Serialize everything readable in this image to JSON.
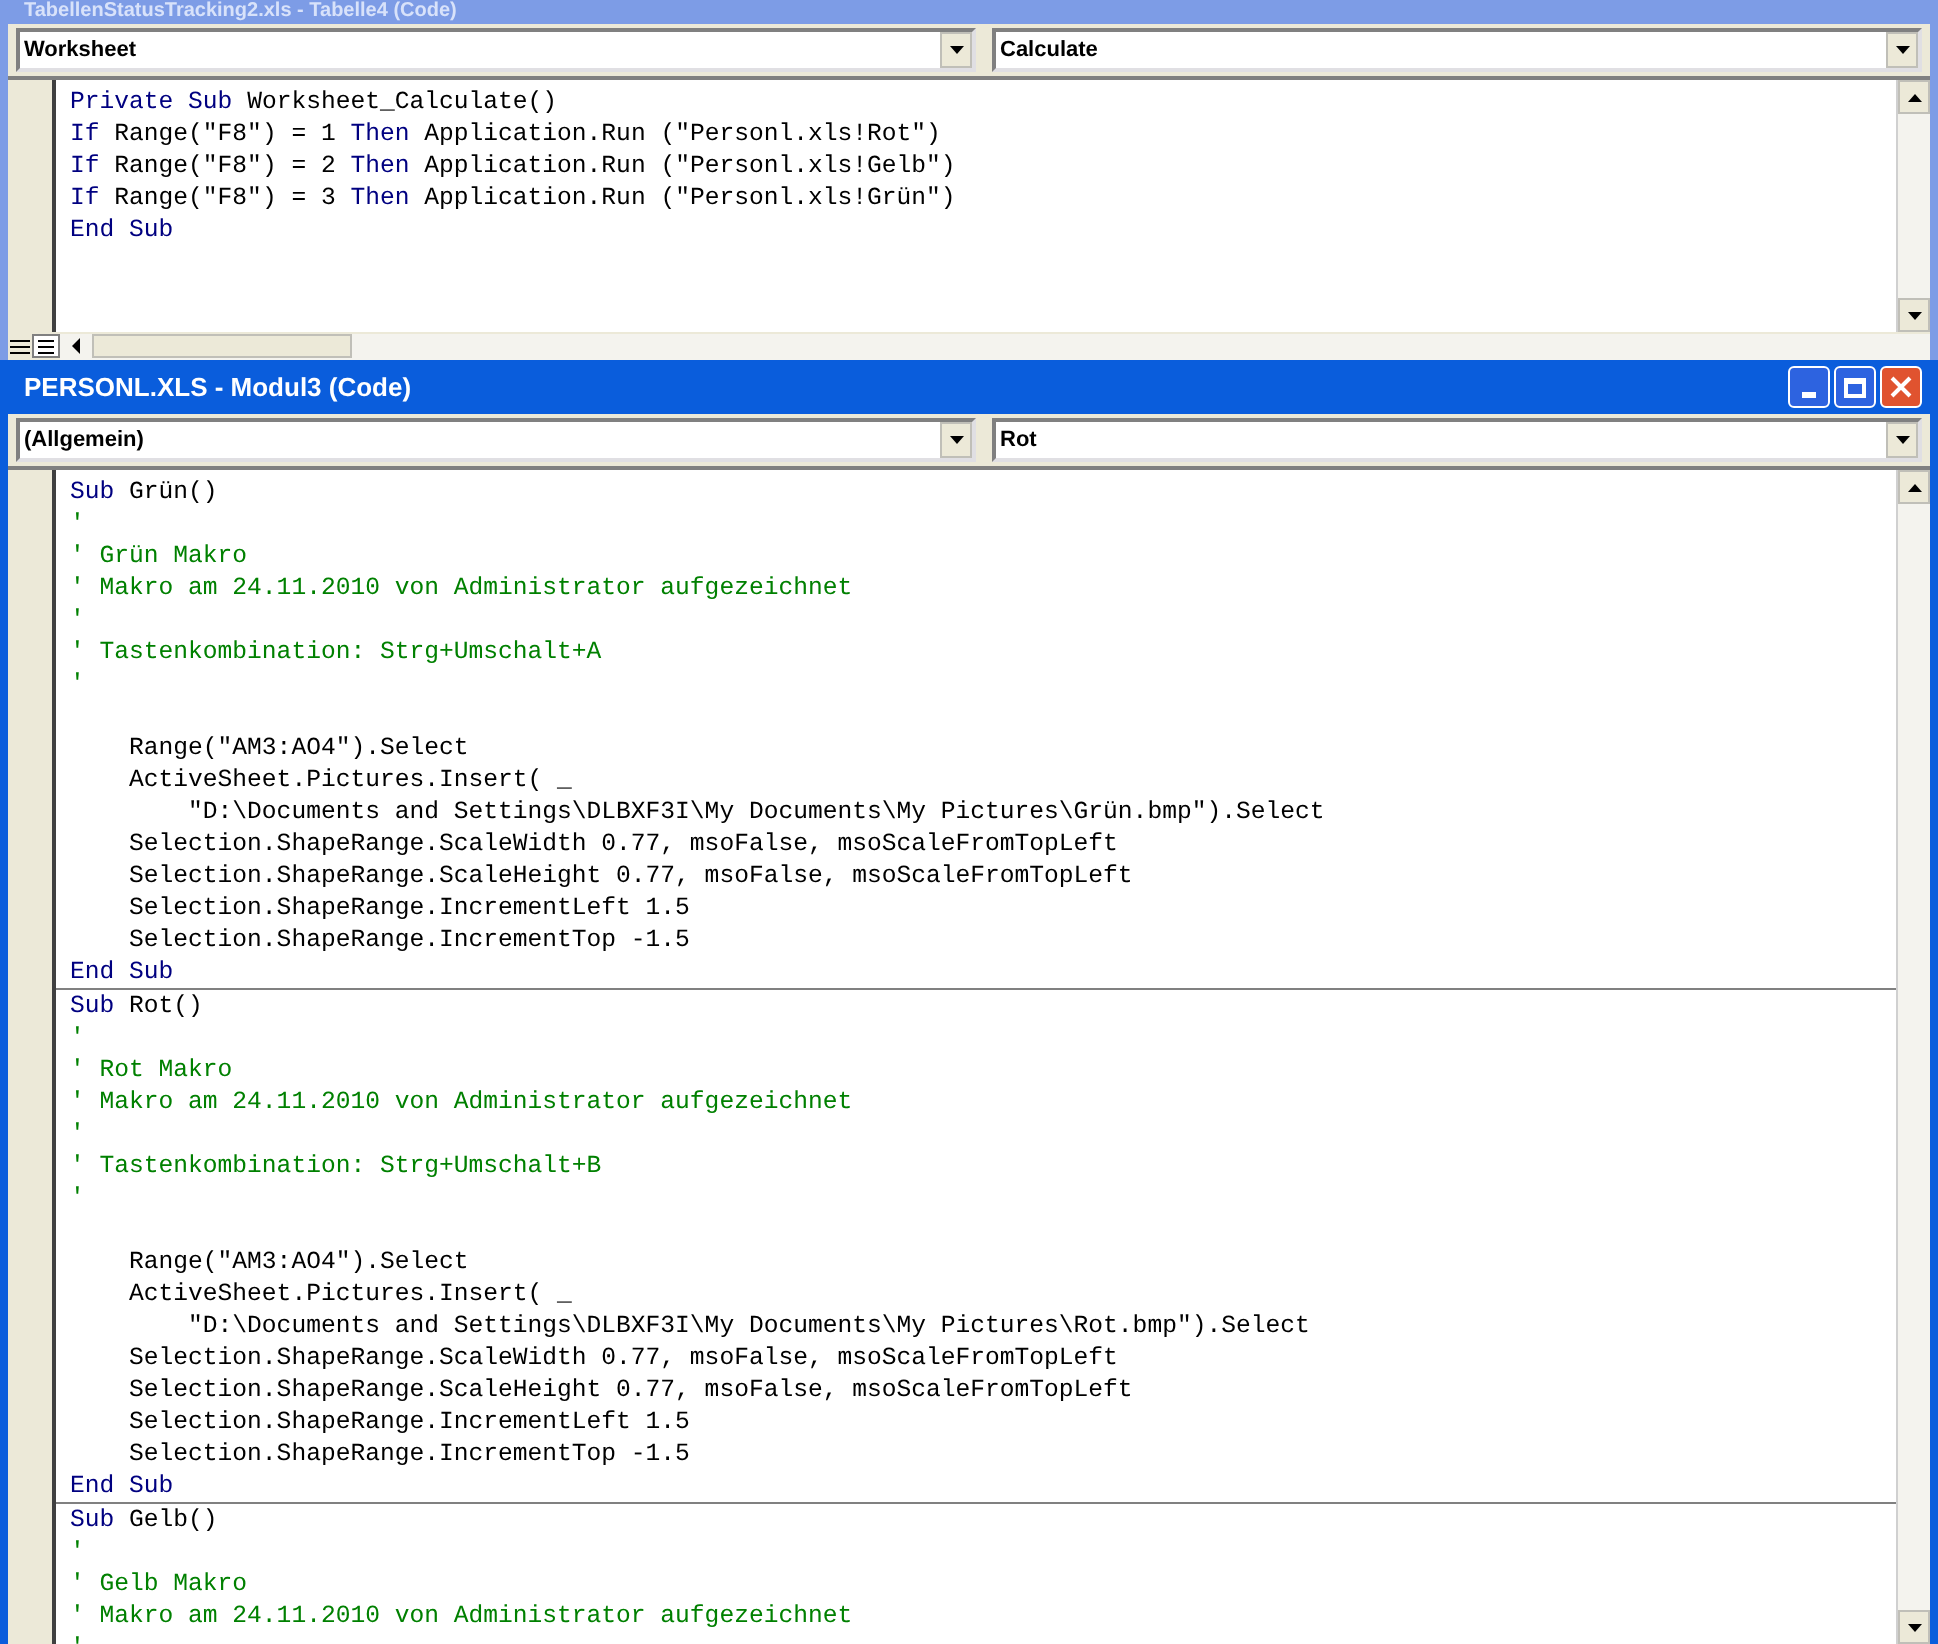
{
  "windows": [
    {
      "title": "TabellenStatusTracking2.xls - Tabelle4 (Code)",
      "active": false,
      "object_dropdown": "Worksheet",
      "procedure_dropdown": "Calculate",
      "procedures": [
        {
          "lines": [
            {
              "parts": [
                {
                  "kind": "keyword",
                  "text": "Private Sub"
                },
                {
                  "kind": "plain",
                  "text": " Worksheet_Calculate()"
                }
              ]
            },
            {
              "parts": [
                {
                  "kind": "keyword",
                  "text": "If"
                },
                {
                  "kind": "plain",
                  "text": " Range(\"F8\") = 1 "
                },
                {
                  "kind": "keyword",
                  "text": "Then"
                },
                {
                  "kind": "plain",
                  "text": " Application.Run (\"Personl.xls!Rot\")"
                }
              ]
            },
            {
              "parts": [
                {
                  "kind": "keyword",
                  "text": "If"
                },
                {
                  "kind": "plain",
                  "text": " Range(\"F8\") = 2 "
                },
                {
                  "kind": "keyword",
                  "text": "Then"
                },
                {
                  "kind": "plain",
                  "text": " Application.Run (\"Personl.xls!Gelb\")"
                }
              ]
            },
            {
              "parts": [
                {
                  "kind": "keyword",
                  "text": "If"
                },
                {
                  "kind": "plain",
                  "text": " Range(\"F8\") = 3 "
                },
                {
                  "kind": "keyword",
                  "text": "Then"
                },
                {
                  "kind": "plain",
                  "text": " Application.Run (\"Personl.xls!Grün\")"
                }
              ]
            },
            {
              "parts": [
                {
                  "kind": "keyword",
                  "text": "End Sub"
                }
              ]
            }
          ]
        }
      ]
    },
    {
      "title": "PERSONL.XLS - Modul3 (Code)",
      "active": true,
      "object_dropdown": "(Allgemein)",
      "procedure_dropdown": "Rot",
      "procedures": [
        {
          "lines": [
            {
              "parts": [
                {
                  "kind": "keyword",
                  "text": "Sub"
                },
                {
                  "kind": "plain",
                  "text": " Grün()"
                }
              ]
            },
            {
              "parts": [
                {
                  "kind": "comment",
                  "text": "'"
                }
              ]
            },
            {
              "parts": [
                {
                  "kind": "comment",
                  "text": "' Grün Makro"
                }
              ]
            },
            {
              "parts": [
                {
                  "kind": "comment",
                  "text": "' Makro am 24.11.2010 von Administrator aufgezeichnet"
                }
              ]
            },
            {
              "parts": [
                {
                  "kind": "comment",
                  "text": "'"
                }
              ]
            },
            {
              "parts": [
                {
                  "kind": "comment",
                  "text": "' Tastenkombination: Strg+Umschalt+A"
                }
              ]
            },
            {
              "parts": [
                {
                  "kind": "comment",
                  "text": "'"
                }
              ]
            },
            {
              "kind": "blank"
            },
            {
              "parts": [
                {
                  "kind": "plain",
                  "text": "    Range(\"AM3:AO4\").Select"
                }
              ]
            },
            {
              "parts": [
                {
                  "kind": "plain",
                  "text": "    ActiveSheet.Pictures.Insert( _"
                }
              ]
            },
            {
              "parts": [
                {
                  "kind": "plain",
                  "text": "        \"D:\\Documents and Settings\\DLBXF3I\\My Documents\\My Pictures\\Grün.bmp\").Select"
                }
              ]
            },
            {
              "parts": [
                {
                  "kind": "plain",
                  "text": "    Selection.ShapeRange.ScaleWidth 0.77, msoFalse, msoScaleFromTopLeft"
                }
              ]
            },
            {
              "parts": [
                {
                  "kind": "plain",
                  "text": "    Selection.ShapeRange.ScaleHeight 0.77, msoFalse, msoScaleFromTopLeft"
                }
              ]
            },
            {
              "parts": [
                {
                  "kind": "plain",
                  "text": "    Selection.ShapeRange.IncrementLeft 1.5"
                }
              ]
            },
            {
              "parts": [
                {
                  "kind": "plain",
                  "text": "    Selection.ShapeRange.IncrementTop -1.5"
                }
              ]
            },
            {
              "parts": [
                {
                  "kind": "keyword",
                  "text": "End Sub"
                }
              ]
            }
          ]
        },
        {
          "lines": [
            {
              "parts": [
                {
                  "kind": "keyword",
                  "text": "Sub"
                },
                {
                  "kind": "plain",
                  "text": " Rot()"
                }
              ]
            },
            {
              "parts": [
                {
                  "kind": "comment",
                  "text": "'"
                }
              ]
            },
            {
              "parts": [
                {
                  "kind": "comment",
                  "text": "' Rot Makro"
                }
              ]
            },
            {
              "parts": [
                {
                  "kind": "comment",
                  "text": "' Makro am 24.11.2010 von Administrator aufgezeichnet"
                }
              ]
            },
            {
              "parts": [
                {
                  "kind": "comment",
                  "text": "'"
                }
              ]
            },
            {
              "parts": [
                {
                  "kind": "comment",
                  "text": "' Tastenkombination: Strg+Umschalt+B"
                }
              ]
            },
            {
              "parts": [
                {
                  "kind": "comment",
                  "text": "'"
                }
              ]
            },
            {
              "kind": "blank"
            },
            {
              "parts": [
                {
                  "kind": "plain",
                  "text": "    Range(\"AM3:AO4\").Select"
                }
              ]
            },
            {
              "parts": [
                {
                  "kind": "plain",
                  "text": "    ActiveSheet.Pictures.Insert( _"
                }
              ]
            },
            {
              "parts": [
                {
                  "kind": "plain",
                  "text": "        \"D:\\Documents and Settings\\DLBXF3I\\My Documents\\My Pictures\\Rot.bmp\").Select"
                }
              ]
            },
            {
              "parts": [
                {
                  "kind": "plain",
                  "text": "    Selection.ShapeRange.ScaleWidth 0.77, msoFalse, msoScaleFromTopLeft"
                }
              ]
            },
            {
              "parts": [
                {
                  "kind": "plain",
                  "text": "    Selection.ShapeRange.ScaleHeight 0.77, msoFalse, msoScaleFromTopLeft"
                }
              ]
            },
            {
              "parts": [
                {
                  "kind": "plain",
                  "text": "    Selection.ShapeRange.IncrementLeft 1.5"
                }
              ]
            },
            {
              "parts": [
                {
                  "kind": "plain",
                  "text": "    Selection.ShapeRange.IncrementTop -1.5"
                }
              ]
            },
            {
              "parts": [
                {
                  "kind": "keyword",
                  "text": "End Sub"
                }
              ]
            }
          ]
        },
        {
          "lines": [
            {
              "parts": [
                {
                  "kind": "keyword",
                  "text": "Sub"
                },
                {
                  "kind": "plain",
                  "text": " Gelb()"
                }
              ]
            },
            {
              "parts": [
                {
                  "kind": "comment",
                  "text": "'"
                }
              ]
            },
            {
              "parts": [
                {
                  "kind": "comment",
                  "text": "' Gelb Makro"
                }
              ]
            },
            {
              "parts": [
                {
                  "kind": "comment",
                  "text": "' Makro am 24.11.2010 von Administrator aufgezeichnet"
                }
              ]
            },
            {
              "parts": [
                {
                  "kind": "comment",
                  "text": "'"
                }
              ]
            }
          ]
        }
      ]
    }
  ]
}
